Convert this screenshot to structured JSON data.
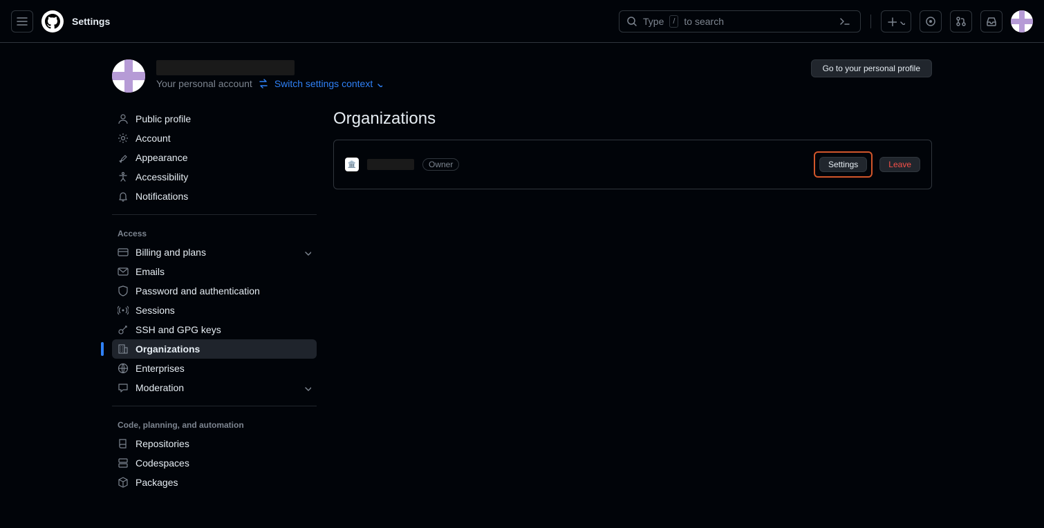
{
  "topbar": {
    "title": "Settings",
    "search_label": "Type",
    "search_key": "/",
    "search_suffix": "to search"
  },
  "header": {
    "subtitle": "Your personal account",
    "switch_label": "Switch settings context",
    "profile_button": "Go to your personal profile"
  },
  "sidebar": {
    "group1": [
      {
        "icon": "person",
        "label": "Public profile"
      },
      {
        "icon": "gear",
        "label": "Account"
      },
      {
        "icon": "brush",
        "label": "Appearance"
      },
      {
        "icon": "accessibility",
        "label": "Accessibility"
      },
      {
        "icon": "bell",
        "label": "Notifications"
      }
    ],
    "group2_title": "Access",
    "group2": [
      {
        "icon": "card",
        "label": "Billing and plans",
        "expand": true
      },
      {
        "icon": "mail",
        "label": "Emails"
      },
      {
        "icon": "shield",
        "label": "Password and authentication"
      },
      {
        "icon": "broadcast",
        "label": "Sessions"
      },
      {
        "icon": "key",
        "label": "SSH and GPG keys"
      },
      {
        "icon": "org",
        "label": "Organizations",
        "active": true
      },
      {
        "icon": "globe",
        "label": "Enterprises"
      },
      {
        "icon": "comment",
        "label": "Moderation",
        "expand": true
      }
    ],
    "group3_title": "Code, planning, and automation",
    "group3": [
      {
        "icon": "repo",
        "label": "Repositories"
      },
      {
        "icon": "codespaces",
        "label": "Codespaces"
      },
      {
        "icon": "package",
        "label": "Packages"
      }
    ]
  },
  "main": {
    "title": "Organizations",
    "org_role": "Owner",
    "settings_btn": "Settings",
    "leave_btn": "Leave"
  }
}
